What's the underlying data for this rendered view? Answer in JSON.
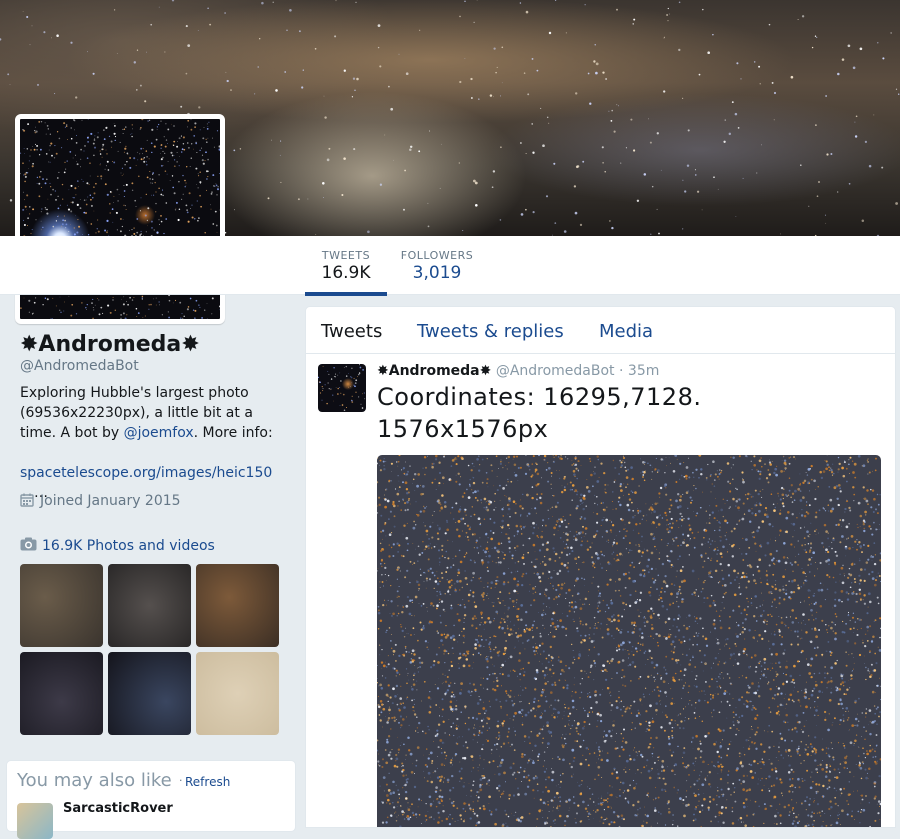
{
  "profile": {
    "name": "✸Andromeda✸",
    "handle": "@AndromedaBot",
    "bio_text": "Exploring Hubble's largest photo (69536x22230px), a little bit at a time. A bot by ",
    "bio_mention": "@joemfox",
    "bio_more": ". More info: ",
    "bio_link": "spacetelescope.org/images/heic150",
    "bio_ellipsis": "…",
    "joined": "Joined January 2015",
    "photos_label": "16.9K Photos and videos"
  },
  "stats": {
    "tweets_label": "TWEETS",
    "tweets_value": "16.9K",
    "followers_label": "FOLLOWERS",
    "followers_value": "3,019"
  },
  "tabs": {
    "tweets": "Tweets",
    "replies": "Tweets & replies",
    "media": "Media"
  },
  "tweet": {
    "name": "✸Andromeda✸",
    "handle": "@AndromedaBot",
    "separator": "·",
    "time": "35m",
    "text": "Coordinates: 16295,7128. 1576x1576px"
  },
  "suggestions": {
    "title": "You may also like",
    "dot": "·",
    "refresh": "Refresh",
    "first_name": "SarcasticRover"
  },
  "icons": {
    "calendar": "calendar-icon",
    "camera": "camera-icon"
  },
  "colors": {
    "link": "#1b4b8f",
    "muted": "#657786",
    "background": "#e6ecf0"
  }
}
